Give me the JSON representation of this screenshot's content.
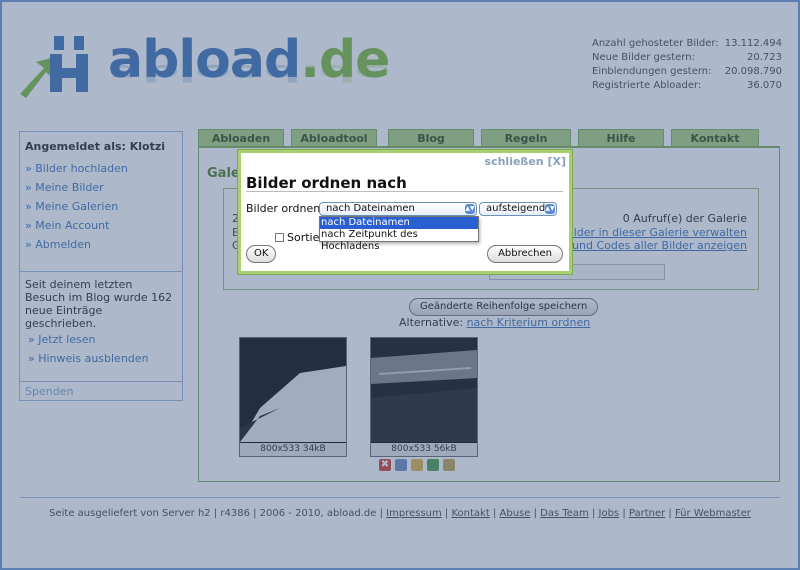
{
  "logo": {
    "text": "abload",
    "tld": ".de"
  },
  "stats": [
    {
      "label": "Anzahl gehosteter Bilder:",
      "value": "13.112.494"
    },
    {
      "label": "Neue Bilder gestern:",
      "value": "20.723"
    },
    {
      "label": "Einblendungen gestern:",
      "value": "20.098.790"
    },
    {
      "label": "Registrierte Abloader:",
      "value": "36.070"
    }
  ],
  "sidebar": {
    "heading": "Angemeldet als: Klotzi",
    "items": [
      "» Bilder hochladen",
      "» Meine Bilder",
      "» Meine Galerien",
      "» Mein Account",
      "» Abmelden"
    ],
    "notice": "Seit deinem letzten Besuch im Blog wurde 162 neue Einträge geschrieben.",
    "notice_links": [
      "» Jetzt lesen",
      "» Hinweis ausblenden"
    ],
    "spenden": "Spenden"
  },
  "tabs": [
    "Abloaden",
    "Abloadtool",
    "Blog",
    "Regeln",
    "Hilfe",
    "Kontakt"
  ],
  "content": {
    "title_fragment": "Gale",
    "calls": "0 Aufruf(e) der Galerie",
    "link_manage": "Bilder in dieser Galerie verwalten",
    "link_codes": "s und Codes aller Bilder anzeigen",
    "frag1": "2",
    "frag2": "E",
    "frag3": "G",
    "save_button": "Geänderte Reihenfolge speichern",
    "alt_label": "Alternative:",
    "alt_link": "nach Kriterium ordnen",
    "thumbs": [
      {
        "caption": "800x533 34kB"
      },
      {
        "caption": "800x533 56kB"
      }
    ]
  },
  "footer": {
    "prefix": "Seite ausgeliefert von Server h2 | r4386 | 2006 - 2010, abload.de |",
    "links": [
      "Impressum",
      "Kontakt",
      "Abuse",
      "Das Team",
      "Jobs",
      "Partner",
      "Für Webmaster"
    ]
  },
  "dialog": {
    "close": "schließen [X]",
    "title": "Bilder ordnen nach",
    "label": "Bilder ordnen",
    "select_value": "nach Dateinamen",
    "order_value": "aufsteigend",
    "options": [
      "nach Dateinamen",
      "nach Zeitpunkt des Hochladens"
    ],
    "checkbox_label": "Sortie",
    "ok": "OK",
    "cancel": "Abbrechen"
  },
  "colors": {
    "brand_blue": "#3a6fb3",
    "brand_green": "#7fb93a",
    "overlay": "#4a648c"
  }
}
